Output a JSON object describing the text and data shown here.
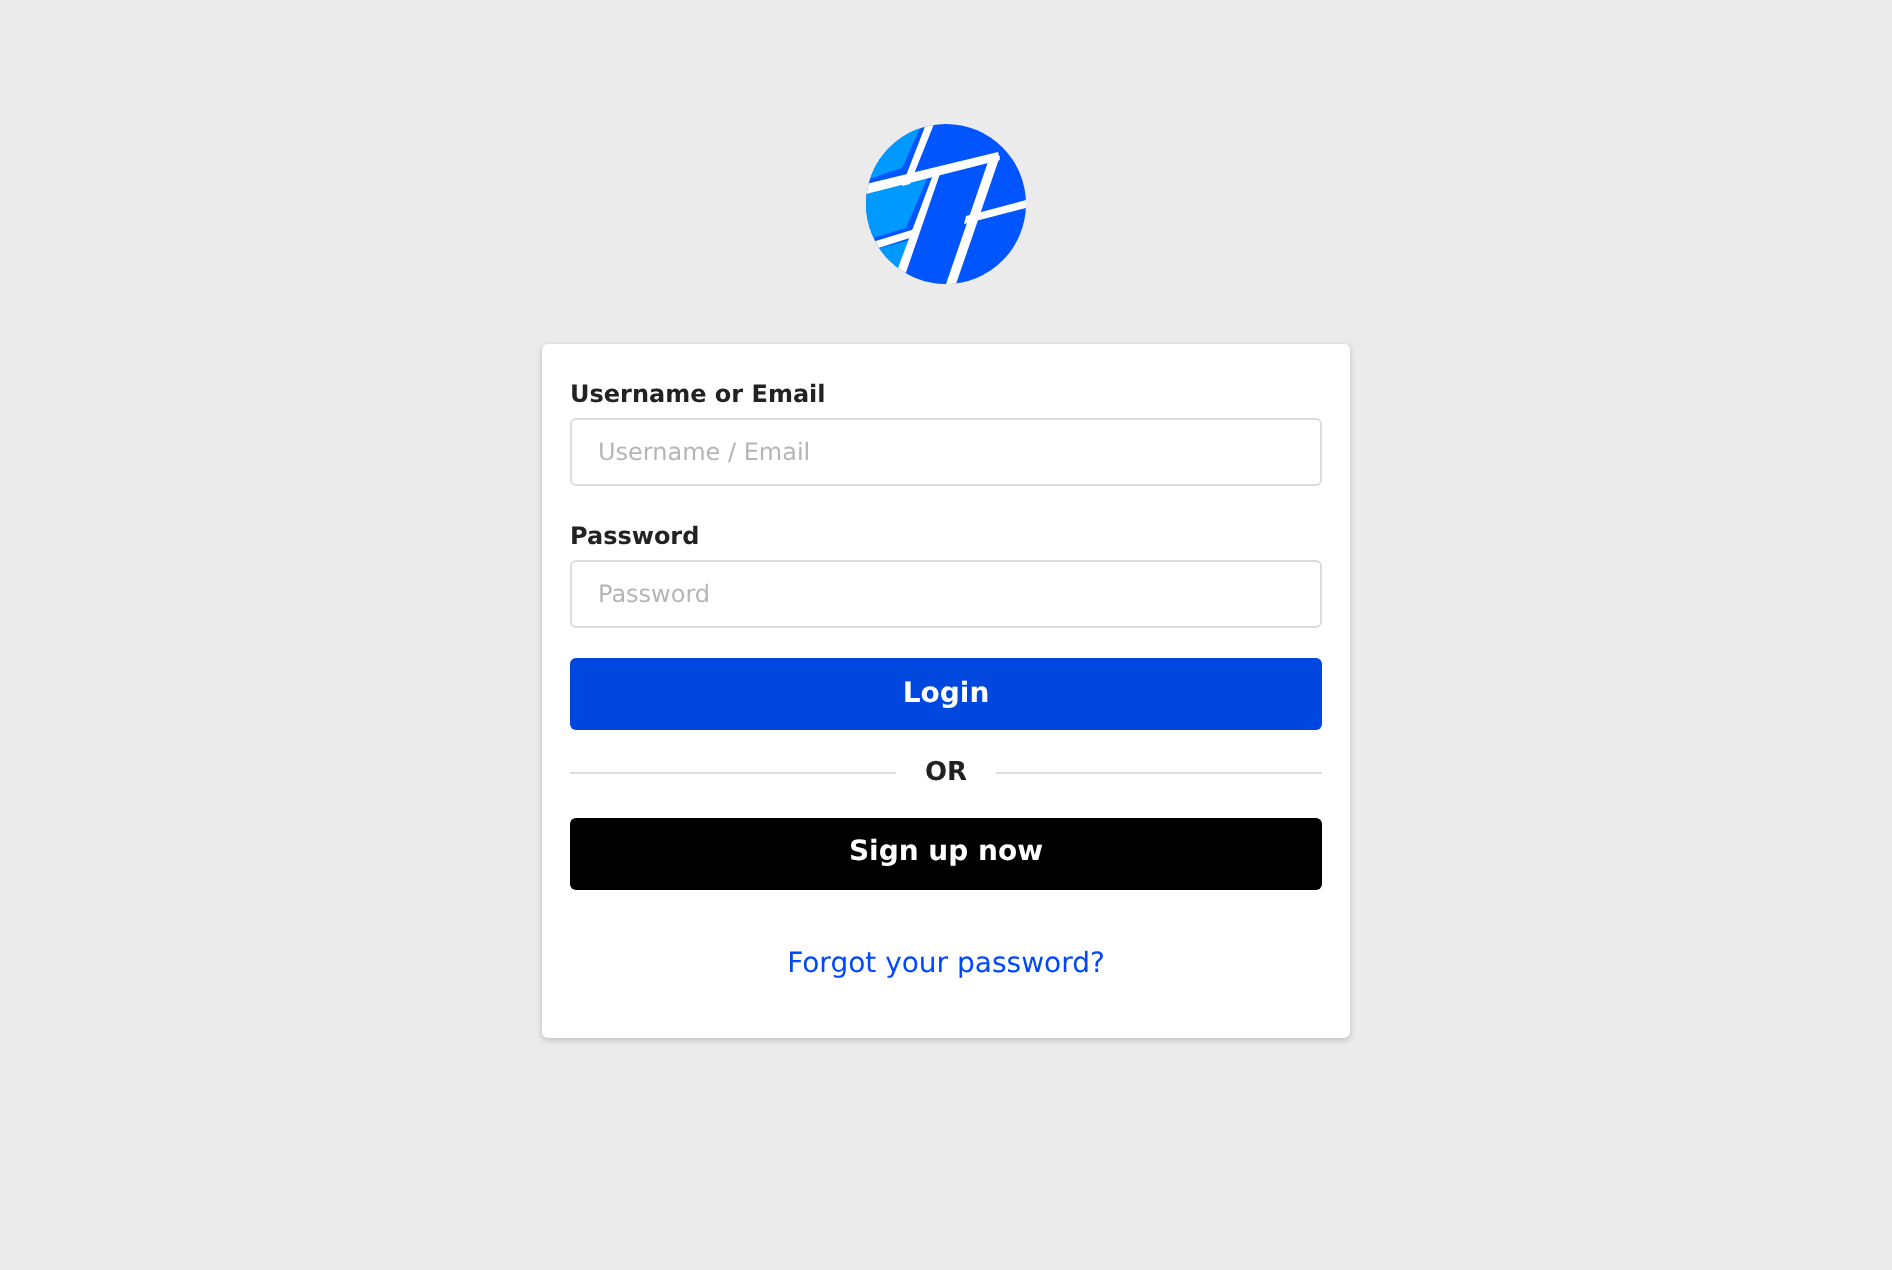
{
  "fields": [
    {
      "label": "Username or Email",
      "placeholder": "Username / Email"
    },
    {
      "label": "Password",
      "placeholder": "Password"
    }
  ],
  "login_button": "Login",
  "divider": "OR",
  "signup_button": "Sign up now",
  "forgot_link": "Forgot your password?"
}
